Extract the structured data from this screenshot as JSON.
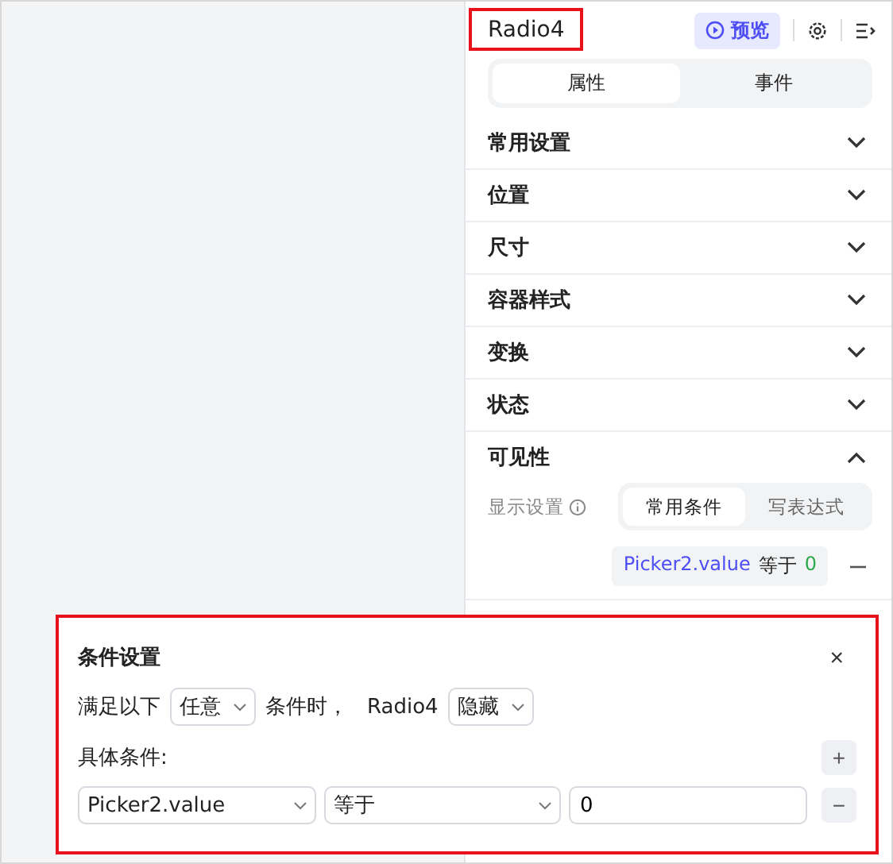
{
  "header": {
    "title": "Radio4",
    "preview_label": "预览"
  },
  "tabs": [
    {
      "label": "属性",
      "selected": true
    },
    {
      "label": "事件",
      "selected": false
    }
  ],
  "sections": [
    {
      "label": "常用设置",
      "expanded": false
    },
    {
      "label": "位置",
      "expanded": false
    },
    {
      "label": "尺寸",
      "expanded": false
    },
    {
      "label": "容器样式",
      "expanded": false
    },
    {
      "label": "变换",
      "expanded": false
    },
    {
      "label": "状态",
      "expanded": false
    },
    {
      "label": "可见性",
      "expanded": true
    }
  ],
  "visibility": {
    "label": "显示设置",
    "modes": [
      {
        "label": "常用条件",
        "selected": true
      },
      {
        "label": "写表达式",
        "selected": false
      }
    ],
    "condition": {
      "field": "Picker2.value",
      "operator": "等于",
      "value": "0"
    }
  },
  "dialog": {
    "title": "条件设置",
    "close": "×",
    "rule": {
      "prefix": "满足以下",
      "match": "任意",
      "middle": "条件时，",
      "target": "Radio4",
      "action": "隐藏"
    },
    "conditions_label": "具体条件:",
    "add": "+",
    "rows": [
      {
        "field": "Picker2.value",
        "operator": "等于",
        "value": "0",
        "remove": "−"
      }
    ]
  }
}
